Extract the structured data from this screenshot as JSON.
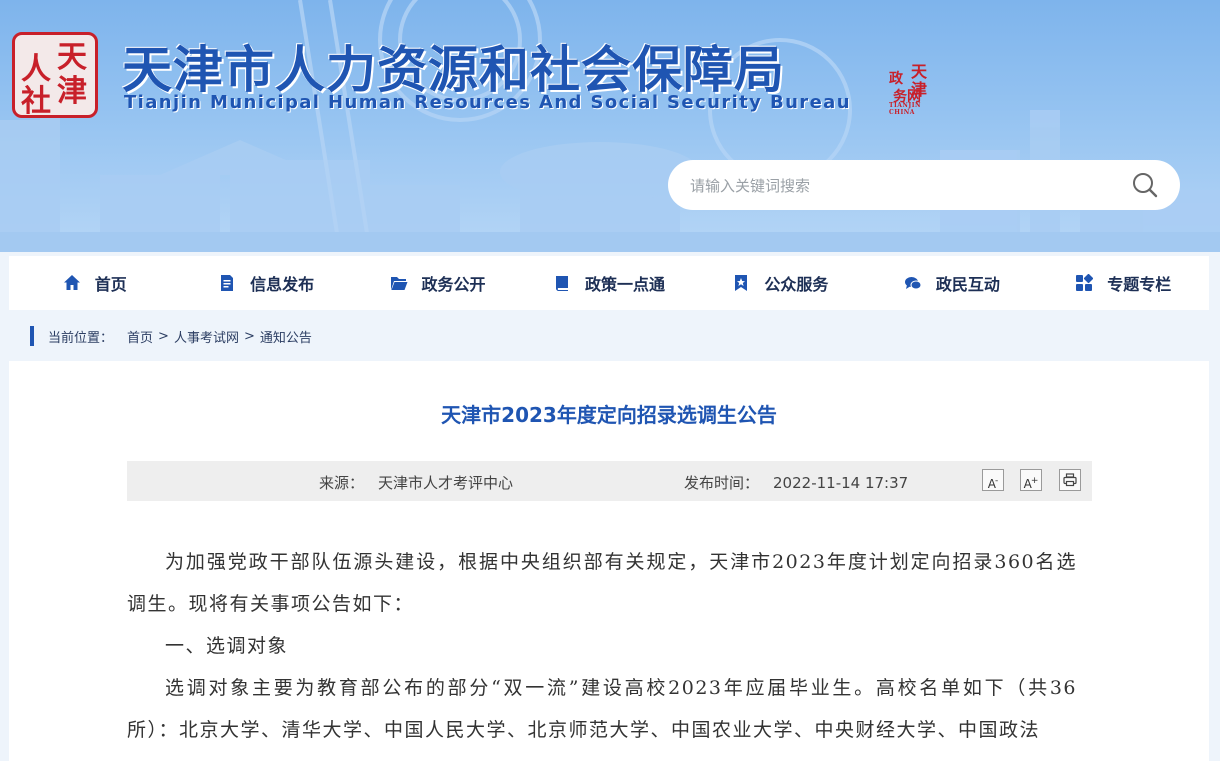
{
  "header": {
    "seal_chars": [
      "人",
      "天",
      "社",
      "津"
    ],
    "title": "天津市人力资源和社会保障局",
    "subtitle": "Tianjin Municipal Human Resources And Social Security Bureau",
    "stamp_chars": [
      "天",
      "政",
      "津",
      "务网"
    ],
    "stamp_small": "TIANJIN CHINA",
    "search_placeholder": "请输入关键词搜索"
  },
  "nav": {
    "items": [
      {
        "label": "首页",
        "icon": "home-icon"
      },
      {
        "label": "信息发布",
        "icon": "document-icon"
      },
      {
        "label": "政务公开",
        "icon": "folder-icon"
      },
      {
        "label": "政策一点通",
        "icon": "book-icon"
      },
      {
        "label": "公众服务",
        "icon": "star-bookmark-icon"
      },
      {
        "label": "政民互动",
        "icon": "chat-icon"
      },
      {
        "label": "专题专栏",
        "icon": "grid-icon"
      }
    ]
  },
  "breadcrumb": {
    "prefix": "当前位置：",
    "items": [
      "首页",
      "人事考试网",
      "通知公告"
    ],
    "separator": ">"
  },
  "article": {
    "title": "天津市2023年度定向招录选调生公告",
    "source_label": "来源：",
    "source": "天津市人才考评中心",
    "time_label": "发布时间：",
    "time": "2022-11-14 17:37",
    "font_decrease": "A",
    "font_increase": "A",
    "minus": "-",
    "plus": "+",
    "paragraphs": [
      "为加强党政干部队伍源头建设，根据中央组织部有关规定，天津市2023年度计划定向招录360名选调生。现将有关事项公告如下：",
      "一、选调对象",
      "选调对象主要为教育部公布的部分“双一流”建设高校2023年应届毕业生。高校名单如下（共36所）：北京大学、清华大学、中国人民大学、北京师范大学、中国农业大学、中央财经大学、中国政法"
    ]
  },
  "colors": {
    "brand_blue": "#1f55b2",
    "seal_red": "#c8202a",
    "nav_text": "#1d2f55"
  }
}
